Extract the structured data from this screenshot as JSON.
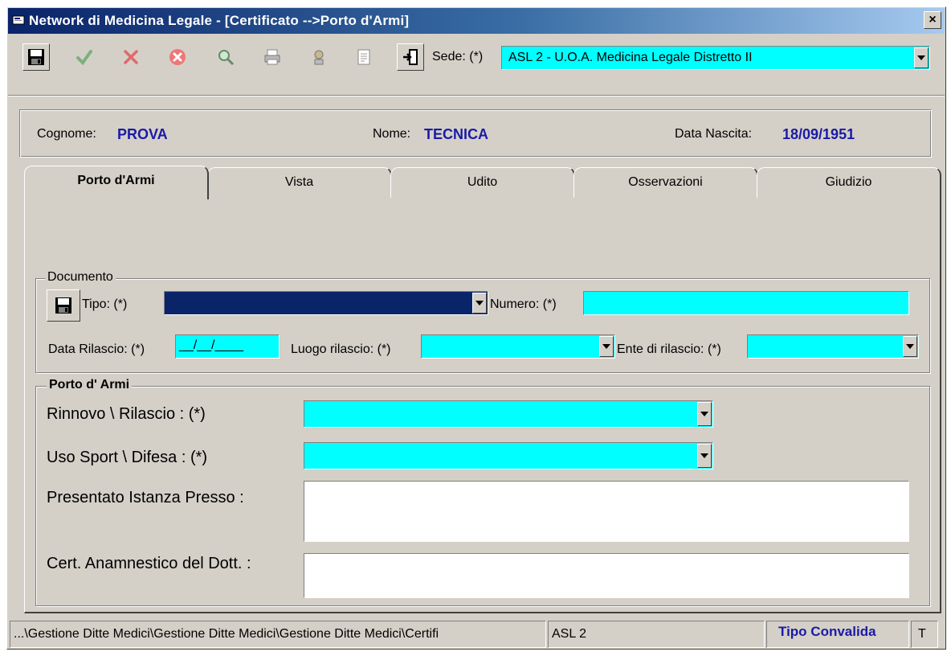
{
  "window": {
    "title": "Network di Medicina Legale - [Certificato -->Porto d'Armi]",
    "close_glyph": "×"
  },
  "toolbar": {
    "buttons": [
      {
        "name": "save",
        "icon": "floppy-disk-icon"
      },
      {
        "name": "confirm",
        "icon": "checkmark-icon"
      },
      {
        "name": "cancel",
        "icon": "red-x-icon"
      },
      {
        "name": "delete",
        "icon": "red-stop-icon"
      },
      {
        "name": "search",
        "icon": "search-icon"
      },
      {
        "name": "print",
        "icon": "printer-icon"
      },
      {
        "name": "user",
        "icon": "user-icon"
      },
      {
        "name": "document",
        "icon": "document-icon"
      },
      {
        "name": "exit",
        "icon": "exit-door-icon"
      }
    ],
    "sede_label": "Sede: (*)",
    "sede_value": "ASL 2 - U.O.A. Medicina Legale Distretto II"
  },
  "patient": {
    "cognome_label": "Cognome:",
    "cognome_value": "PROVA",
    "nome_label": "Nome:",
    "nome_value": "TECNICA",
    "data_nascita_label": "Data Nascita:",
    "data_nascita_value": "18/09/1951"
  },
  "tabs": [
    {
      "label": "Porto d'Armi",
      "active": true
    },
    {
      "label": "Vista",
      "active": false
    },
    {
      "label": "Udito",
      "active": false
    },
    {
      "label": "Osservazioni",
      "active": false
    },
    {
      "label": "Giudizio",
      "active": false
    }
  ],
  "documento": {
    "group_title": "Documento",
    "tipo_label": "Tipo:  (*)",
    "tipo_value": "",
    "numero_label": "Numero:  (*)",
    "numero_value": "",
    "data_rilascio_label": "Data Rilascio:  (*)",
    "data_rilascio_value": "__/__/____",
    "luogo_rilascio_label": "Luogo rilascio:  (*)",
    "luogo_rilascio_value": "",
    "ente_rilascio_label": "Ente di rilascio: (*)",
    "ente_rilascio_value": ""
  },
  "porto_armi": {
    "group_title": "Porto d' Armi",
    "rinnovo_label": "Rinnovo \\ Rilascio :  (*)",
    "rinnovo_value": "",
    "uso_label": "Uso Sport \\ Difesa :  (*)",
    "uso_value": "",
    "istanza_label": "Presentato Istanza Presso :",
    "istanza_value": "",
    "cert_label": "Cert. Anamnestico del Dott. :",
    "cert_value": ""
  },
  "statusbar": {
    "path": "...\\Gestione Ditte Medici\\Gestione Ditte Medici\\Gestione Ditte Medici\\Certifi",
    "asl": "ASL 2",
    "tipo": "Tipo Convalida",
    "t": "T"
  },
  "colors": {
    "field_cyan": "#00ffff",
    "title_blue": "#0a246a",
    "value_blue": "#1a1aa6",
    "face": "#d4d0c8"
  }
}
